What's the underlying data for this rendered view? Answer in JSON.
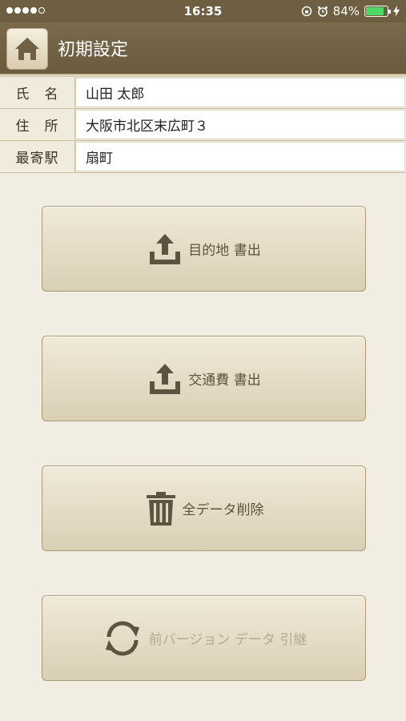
{
  "status_bar": {
    "time": "16:35",
    "battery_percent": "84%",
    "battery_level": 0.84
  },
  "navbar": {
    "title": "初期設定",
    "home_icon": "home-icon"
  },
  "profile": [
    {
      "label": "氏　名",
      "value": "山田 太郎"
    },
    {
      "label": "住　所",
      "value": "大阪市北区末広町３"
    },
    {
      "label": "最寄駅",
      "value": "扇町"
    }
  ],
  "actions": [
    {
      "label": "目的地 書出",
      "icon": "export-icon",
      "enabled": true
    },
    {
      "label": "交通費 書出",
      "icon": "export-icon",
      "enabled": true
    },
    {
      "label": "全データ削除",
      "icon": "trash-icon",
      "enabled": true
    },
    {
      "label": "前バージョン データ 引継",
      "icon": "sync-icon",
      "enabled": false
    }
  ],
  "colors": {
    "nav_bg": "#6f5f42",
    "background": "#f2ede2",
    "icon": "#5e5240",
    "disabled_text": "#b4aa96"
  }
}
